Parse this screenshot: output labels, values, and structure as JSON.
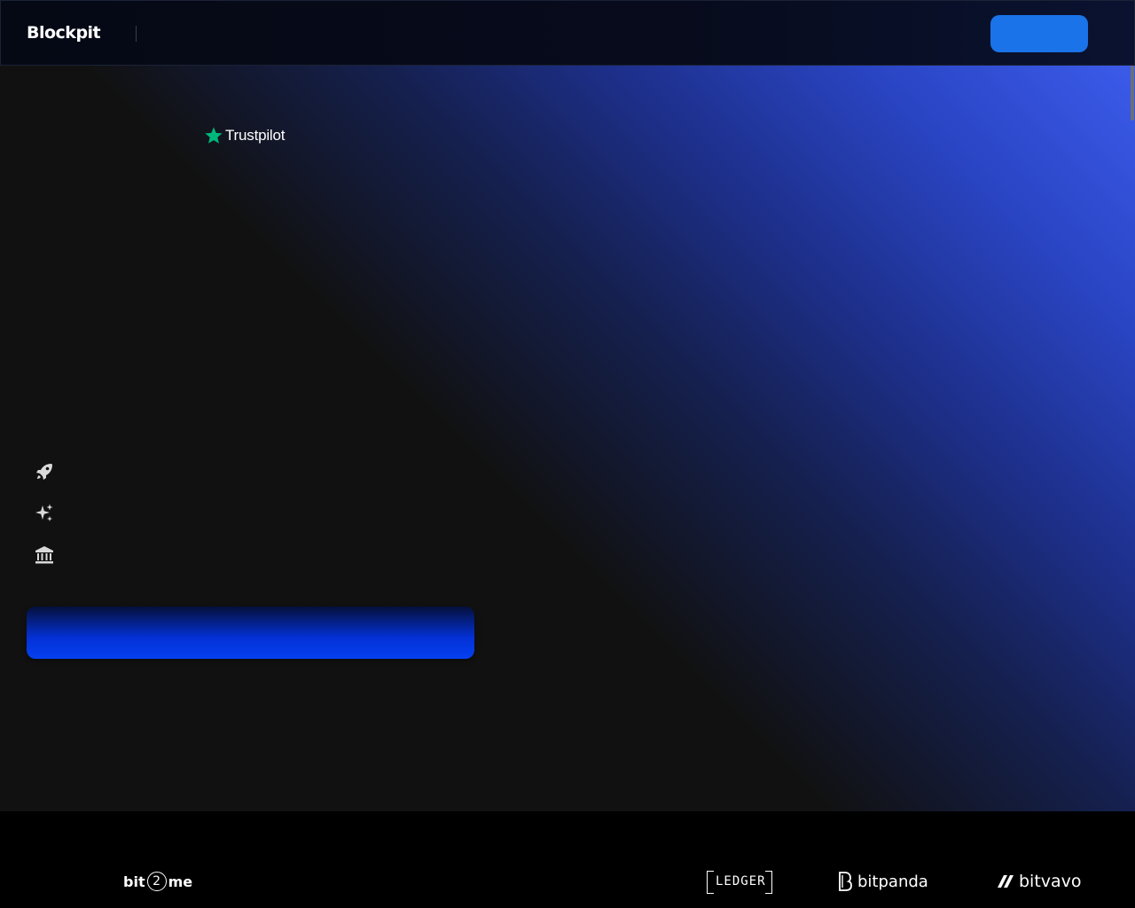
{
  "header": {
    "logo_text": "Blockpit",
    "cta_label": ""
  },
  "hero": {
    "trustpilot_label": "Trustpilot",
    "features": [
      {
        "icon": "rocket-icon"
      },
      {
        "icon": "sparkles-icon"
      },
      {
        "icon": "bank-icon"
      }
    ],
    "cta_label": ""
  },
  "partners": {
    "bit2me": {
      "prefix": "bit",
      "digit": "2",
      "suffix": "me"
    },
    "ledger": "LEDGER",
    "bitpanda": "bitpanda",
    "bitvavo": "bitvavo"
  },
  "colors": {
    "accent": "#1a73e8",
    "trustpilot_green": "#00b67a",
    "cta_blue": "#0540f0",
    "background": "#111111"
  }
}
